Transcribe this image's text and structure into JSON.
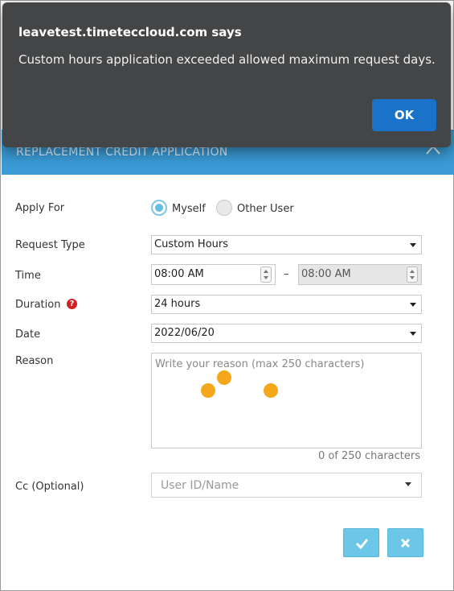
{
  "alert": {
    "title": "leavetest.timeteccloud.com says",
    "message": "Custom hours application exceeded allowed maximum request days.",
    "ok_label": "OK"
  },
  "panel": {
    "title": "REPLACEMENT CREDIT APPLICATION",
    "header_color": "#3a9bd5"
  },
  "form": {
    "apply_for": {
      "label": "Apply For",
      "options": [
        "Myself",
        "Other User"
      ],
      "selected": "Myself"
    },
    "request_type": {
      "label": "Request Type",
      "value": "Custom Hours"
    },
    "time": {
      "label": "Time",
      "from": "08:00 AM",
      "separator": "–",
      "to": "08:00 AM"
    },
    "duration": {
      "label": "Duration",
      "value": "24 hours",
      "help_glyph": "?"
    },
    "date": {
      "label": "Date",
      "value": "2022/06/20"
    },
    "reason": {
      "label": "Reason",
      "placeholder": "Write your reason (max 250 characters)",
      "char_count": "0 of 250 characters"
    },
    "cc": {
      "label": "Cc (Optional)",
      "placeholder": "User ID/Name"
    }
  },
  "actions": {
    "submit_icon": "check-icon",
    "cancel_icon": "close-icon",
    "button_color": "#6cc6e8"
  },
  "loading_indicator": {
    "dot_color": "#f4a71b"
  }
}
